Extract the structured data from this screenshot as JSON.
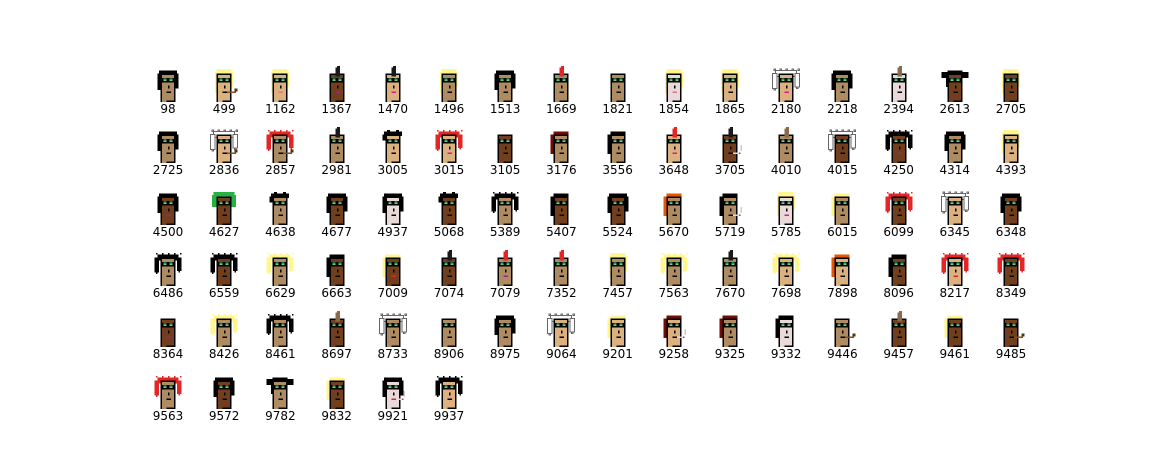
{
  "punks": [
    {
      "id": "98",
      "skin": "#ae8b61",
      "hair": "black",
      "hairColor": "#000000",
      "mouth": "#000000"
    },
    {
      "id": "499",
      "skin": "#dbb180",
      "hair": "blonde",
      "hairColor": "#fff68e",
      "mouth": "#000000",
      "extra": "pipe"
    },
    {
      "id": "1162",
      "skin": "#dbb180",
      "hair": "blonde",
      "hairColor": "#fff68e",
      "mouth": "#d87b7b"
    },
    {
      "id": "1367",
      "skin": "#713f1d",
      "hair": "mohawk",
      "hairColor": "#1a1a1a",
      "mouth": "#a3207b"
    },
    {
      "id": "1470",
      "skin": "#dbb180",
      "hair": "mohawk",
      "hairColor": "#1a1a1a",
      "mouth": "#d51e8c"
    },
    {
      "id": "1496",
      "skin": "#ae8b61",
      "hair": "blonde",
      "hairColor": "#fff68e",
      "mouth": "#000000"
    },
    {
      "id": "1513",
      "skin": "#ae8b61",
      "hair": "black",
      "hairColor": "#000000",
      "mouth": "#000000"
    },
    {
      "id": "1669",
      "skin": "#ae8b61",
      "hair": "mohawk",
      "hairColor": "#e22626",
      "mouth": "#000000"
    },
    {
      "id": "1821",
      "skin": "#ae8b61",
      "hair": "none",
      "hairColor": "#000000",
      "mouth": "#000000"
    },
    {
      "id": "1854",
      "skin": "#ead9d9",
      "hair": "blonde",
      "hairColor": "#fff68e",
      "mouth": "#d87b7b"
    },
    {
      "id": "1865",
      "skin": "#dbb180",
      "hair": "blonde",
      "hairColor": "#fff68e",
      "mouth": "#000000"
    },
    {
      "id": "2180",
      "skin": "#dbb180",
      "hair": "wild",
      "hairColor": "#ffffff",
      "mouth": "#d51e8c"
    },
    {
      "id": "2218",
      "skin": "#ae8b61",
      "hair": "black",
      "hairColor": "#000000",
      "mouth": "#000000"
    },
    {
      "id": "2394",
      "skin": "#ead9d9",
      "hair": "mohawk",
      "hairColor": "#8a6a4a",
      "mouth": "#000000"
    },
    {
      "id": "2613",
      "skin": "#713f1d",
      "hair": "pigtails",
      "hairColor": "#000000",
      "mouth": "#000000"
    },
    {
      "id": "2705",
      "skin": "#713f1d",
      "hair": "blonde",
      "hairColor": "#fff68e",
      "mouth": "#000000"
    },
    {
      "id": "2725",
      "skin": "#ae8b61",
      "hair": "black",
      "hairColor": "#000000",
      "mouth": "#000000"
    },
    {
      "id": "2836",
      "skin": "#dbb180",
      "hair": "wild",
      "hairColor": "#ffffff",
      "mouth": "#000000",
      "extra": "pipe"
    },
    {
      "id": "2857",
      "skin": "#ae8b61",
      "hair": "wild",
      "hairColor": "#e22626",
      "mouth": "#000000",
      "extra": "pipe"
    },
    {
      "id": "2981",
      "skin": "#ae8b61",
      "hair": "mohawk",
      "hairColor": "#1a1a1a",
      "mouth": "#000000"
    },
    {
      "id": "3005",
      "skin": "#dbb180",
      "hair": "messy",
      "hairColor": "#000000",
      "mouth": "#000000"
    },
    {
      "id": "3015",
      "skin": "#dbb180",
      "hair": "wild",
      "hairColor": "#e22626",
      "mouth": "#d51e8c"
    },
    {
      "id": "3105",
      "skin": "#713f1d",
      "hair": "none",
      "hairColor": "#000000",
      "mouth": "#000000"
    },
    {
      "id": "3176",
      "skin": "#ae8b61",
      "hair": "straight",
      "hairColor": "#710c00",
      "mouth": "#000000"
    },
    {
      "id": "3556",
      "skin": "#ae8b61",
      "hair": "straight",
      "hairColor": "#000000",
      "mouth": "#000000"
    },
    {
      "id": "3648",
      "skin": "#dbb180",
      "hair": "mohawk",
      "hairColor": "#e22626",
      "mouth": "#d51e8c"
    },
    {
      "id": "3705",
      "skin": "#713f1d",
      "hair": "mohawk",
      "hairColor": "#1a1a1a",
      "mouth": "#000000",
      "extra": "cig"
    },
    {
      "id": "4010",
      "skin": "#ae8b61",
      "hair": "mohawk",
      "hairColor": "#8a6a4a",
      "mouth": "#000000"
    },
    {
      "id": "4015",
      "skin": "#713f1d",
      "hair": "wild",
      "hairColor": "#ffffff",
      "mouth": "#000000"
    },
    {
      "id": "4250",
      "skin": "#713f1d",
      "hair": "wild",
      "hairColor": "#000000",
      "mouth": "#a3207b"
    },
    {
      "id": "4314",
      "skin": "#ae8b61",
      "hair": "black",
      "hairColor": "#000000",
      "mouth": "#000000"
    },
    {
      "id": "4393",
      "skin": "#dbb180",
      "hair": "blonde",
      "hairColor": "#fff68e",
      "mouth": "#000000"
    },
    {
      "id": "4500",
      "skin": "#713f1d",
      "hair": "black",
      "hairColor": "#000000",
      "mouth": "#a3207b"
    },
    {
      "id": "4627",
      "skin": "#713f1d",
      "hair": "frumpy",
      "hairColor": "#28b143",
      "mouth": "#000000"
    },
    {
      "id": "4638",
      "skin": "#ae8b61",
      "hair": "messy",
      "hairColor": "#000000",
      "mouth": "#000000"
    },
    {
      "id": "4677",
      "skin": "#713f1d",
      "hair": "black",
      "hairColor": "#000000",
      "mouth": "#000000"
    },
    {
      "id": "4937",
      "skin": "#ead9d9",
      "hair": "black",
      "hairColor": "#000000",
      "mouth": "#000000"
    },
    {
      "id": "5068",
      "skin": "#713f1d",
      "hair": "messy",
      "hairColor": "#000000",
      "mouth": "#000000"
    },
    {
      "id": "5389",
      "skin": "#ae8b61",
      "hair": "wild",
      "hairColor": "#000000",
      "mouth": "#000000"
    },
    {
      "id": "5407",
      "skin": "#713f1d",
      "hair": "straight",
      "hairColor": "#000000",
      "mouth": "#000000"
    },
    {
      "id": "5524",
      "skin": "#713f1d",
      "hair": "black",
      "hairColor": "#000000",
      "mouth": "#000000"
    },
    {
      "id": "5670",
      "skin": "#ae8b61",
      "hair": "straight",
      "hairColor": "#e65700",
      "mouth": "#000000"
    },
    {
      "id": "5719",
      "skin": "#ae8b61",
      "hair": "straight",
      "hairColor": "#000000",
      "mouth": "#000000",
      "extra": "cig"
    },
    {
      "id": "5785",
      "skin": "#ead9d9",
      "hair": "blonde",
      "hairColor": "#fff68e",
      "mouth": "#d51e8c"
    },
    {
      "id": "6015",
      "skin": "#ae8b61",
      "hair": "straight",
      "hairColor": "#fff68e",
      "mouth": "#000000"
    },
    {
      "id": "6099",
      "skin": "#713f1d",
      "hair": "wild",
      "hairColor": "#e22626",
      "mouth": "#000000"
    },
    {
      "id": "6345",
      "skin": "#dbb180",
      "hair": "wild",
      "hairColor": "#ffffff",
      "mouth": "#000000"
    },
    {
      "id": "6348",
      "skin": "#713f1d",
      "hair": "black",
      "hairColor": "#000000",
      "mouth": "#000000"
    },
    {
      "id": "6486",
      "skin": "#ae8b61",
      "hair": "wild",
      "hairColor": "#000000",
      "mouth": "#000000"
    },
    {
      "id": "6559",
      "skin": "#713f1d",
      "hair": "wild",
      "hairColor": "#000000",
      "mouth": "#000000"
    },
    {
      "id": "6629",
      "skin": "#ae8b61",
      "hair": "wild",
      "hairColor": "#fff68e",
      "mouth": "#000000"
    },
    {
      "id": "6663",
      "skin": "#713f1d",
      "hair": "straight",
      "hairColor": "#000000",
      "mouth": "#000000"
    },
    {
      "id": "7009",
      "skin": "#713f1d",
      "hair": "straight",
      "hairColor": "#fff68e",
      "mouth": "#e22626"
    },
    {
      "id": "7074",
      "skin": "#713f1d",
      "hair": "mohawk",
      "hairColor": "#1a1a1a",
      "mouth": "#000000"
    },
    {
      "id": "7079",
      "skin": "#ae8b61",
      "hair": "mohawk",
      "hairColor": "#e22626",
      "mouth": "#a3207b"
    },
    {
      "id": "7352",
      "skin": "#ae8b61",
      "hair": "mohawk",
      "hairColor": "#e22626",
      "mouth": "#000000"
    },
    {
      "id": "7457",
      "skin": "#ae8b61",
      "hair": "blonde",
      "hairColor": "#fff68e",
      "mouth": "#000000"
    },
    {
      "id": "7563",
      "skin": "#ae8b61",
      "hair": "wild",
      "hairColor": "#fff68e",
      "mouth": "#000000"
    },
    {
      "id": "7670",
      "skin": "#ae8b61",
      "hair": "mohawk",
      "hairColor": "#1a1a1a",
      "mouth": "#000000"
    },
    {
      "id": "7698",
      "skin": "#dbb180",
      "hair": "wild",
      "hairColor": "#fff68e",
      "mouth": "#000000"
    },
    {
      "id": "7898",
      "skin": "#dbb180",
      "hair": "straight",
      "hairColor": "#e65700",
      "mouth": "#000000"
    },
    {
      "id": "8096",
      "skin": "#713f1d",
      "hair": "straight",
      "hairColor": "#000000",
      "mouth": "#000000"
    },
    {
      "id": "8217",
      "skin": "#dbb180",
      "hair": "wild",
      "hairColor": "#e22626",
      "mouth": "#e22626"
    },
    {
      "id": "8349",
      "skin": "#713f1d",
      "hair": "wild",
      "hairColor": "#e22626",
      "mouth": "#000000"
    },
    {
      "id": "8364",
      "skin": "#713f1d",
      "hair": "none",
      "hairColor": "#000000",
      "mouth": "#a3207b"
    },
    {
      "id": "8426",
      "skin": "#ae8b61",
      "hair": "wild",
      "hairColor": "#fff68e",
      "mouth": "#000000"
    },
    {
      "id": "8461",
      "skin": "#ae8b61",
      "hair": "wild",
      "hairColor": "#000000",
      "mouth": "#000000"
    },
    {
      "id": "8697",
      "skin": "#713f1d",
      "hair": "mohawk",
      "hairColor": "#8a6a4a",
      "mouth": "#000000"
    },
    {
      "id": "8733",
      "skin": "#ae8b61",
      "hair": "wild",
      "hairColor": "#ffffff",
      "mouth": "#000000"
    },
    {
      "id": "8906",
      "skin": "#ae8b61",
      "hair": "none",
      "hairColor": "#000000",
      "mouth": "#000000"
    },
    {
      "id": "8975",
      "skin": "#ae8b61",
      "hair": "black",
      "hairColor": "#000000",
      "mouth": "#000000"
    },
    {
      "id": "9064",
      "skin": "#dbb180",
      "hair": "wild",
      "hairColor": "#ffffff",
      "mouth": "#000000"
    },
    {
      "id": "9201",
      "skin": "#dbb180",
      "hair": "straight",
      "hairColor": "#fff68e",
      "mouth": "#000000"
    },
    {
      "id": "9258",
      "skin": "#dbb180",
      "hair": "straight",
      "hairColor": "#710c00",
      "mouth": "#000000",
      "extra": "cig"
    },
    {
      "id": "9325",
      "skin": "#ae8b61",
      "hair": "straight",
      "hairColor": "#710c00",
      "mouth": "#000000"
    },
    {
      "id": "9332",
      "skin": "#ead9d9",
      "hair": "straight",
      "hairColor": "#000000",
      "mouth": "#000000"
    },
    {
      "id": "9446",
      "skin": "#ae8b61",
      "hair": "none",
      "hairColor": "#000000",
      "mouth": "#000000",
      "extra": "pipe"
    },
    {
      "id": "9457",
      "skin": "#713f1d",
      "hair": "mohawk",
      "hairColor": "#8a6a4a",
      "mouth": "#000000"
    },
    {
      "id": "9461",
      "skin": "#713f1d",
      "hair": "straight",
      "hairColor": "#fff68e",
      "mouth": "#000000"
    },
    {
      "id": "9485",
      "skin": "#713f1d",
      "hair": "none",
      "hairColor": "#000000",
      "mouth": "#000000",
      "extra": "pipe"
    },
    {
      "id": "9563",
      "skin": "#ae8b61",
      "hair": "wild",
      "hairColor": "#e22626",
      "mouth": "#000000"
    },
    {
      "id": "9572",
      "skin": "#713f1d",
      "hair": "black",
      "hairColor": "#000000",
      "mouth": "#000000"
    },
    {
      "id": "9782",
      "skin": "#ae8b61",
      "hair": "pigtails",
      "hairColor": "#000000",
      "mouth": "#000000"
    },
    {
      "id": "9832",
      "skin": "#713f1d",
      "hair": "straight",
      "hairColor": "#fff68e",
      "mouth": "#000000"
    },
    {
      "id": "9921",
      "skin": "#ead9d9",
      "hair": "black",
      "hairColor": "#000000",
      "mouth": "#e22626",
      "extra": "cig"
    },
    {
      "id": "9937",
      "skin": "#dbb180",
      "hair": "wild",
      "hairColor": "#000000",
      "mouth": "#000000"
    }
  ]
}
